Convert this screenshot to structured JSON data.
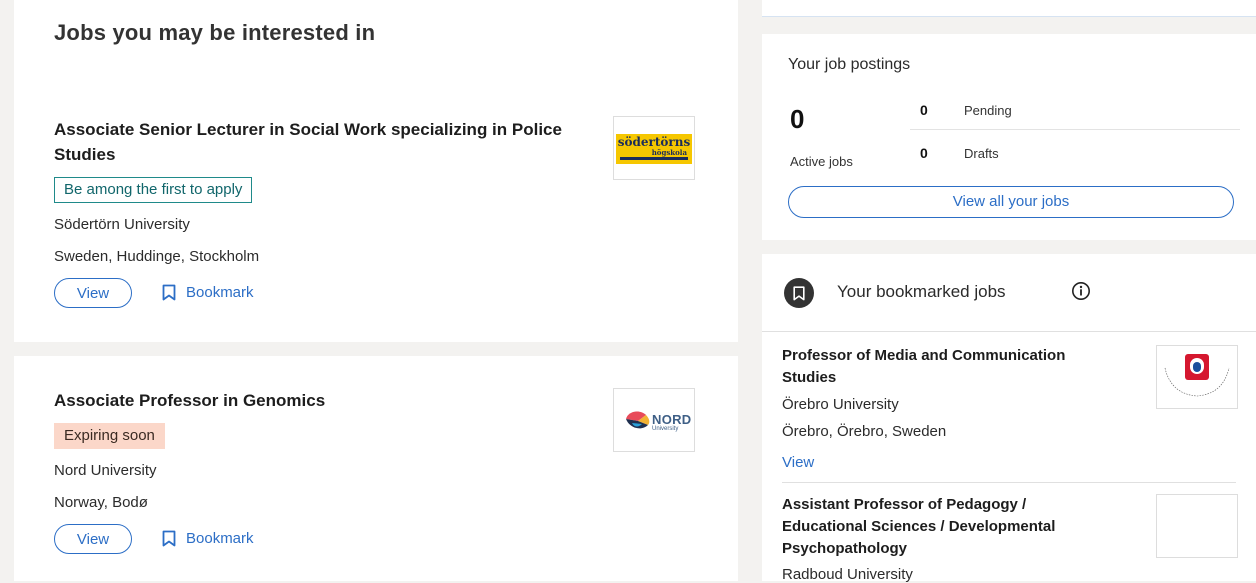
{
  "main": {
    "section_title": "Jobs you may be interested in",
    "jobs": [
      {
        "title": "Associate Senior Lecturer in Social Work specializing in Police Studies",
        "badge": "Be among the first to apply",
        "institution": "Södertörn University",
        "location": "Sweden, Huddinge, Stockholm",
        "view_label": "View",
        "bookmark_label": "Bookmark",
        "logo": {
          "line1": "södertörns",
          "line2": "högskola",
          "bg_color": "#f6c700",
          "text_color": "#1b2c5a"
        }
      },
      {
        "title": "Associate Professor in Genomics",
        "badge": "Expiring soon",
        "institution": "Nord University",
        "location": "Norway, Bodø",
        "view_label": "View",
        "bookmark_label": "Bookmark",
        "logo": {
          "line1": "NORD",
          "line2": "University"
        }
      }
    ]
  },
  "postings": {
    "title": "Your job postings",
    "active_count": "0",
    "active_label": "Active jobs",
    "pending_count": "0",
    "pending_label": "Pending",
    "drafts_count": "0",
    "drafts_label": "Drafts",
    "view_all_label": "View all your jobs"
  },
  "bookmarks": {
    "title": "Your bookmarked jobs",
    "items": [
      {
        "title_line1": "Professor of Media and Communication",
        "title_line2": "Studies",
        "institution": "Örebro University",
        "location": "Örebro, Örebro, Sweden",
        "view_label": "View"
      },
      {
        "title_line1": "Assistant Professor of Pedagogy /",
        "title_line2": "Educational Sciences / Developmental",
        "title_line3": "Psychopathology",
        "institution": "Radboud University"
      }
    ]
  },
  "colors": {
    "accent": "#2c6ec6",
    "badge_first_border": "#1f8a8a",
    "badge_expiring_bg": "#fbd7c9",
    "page_bg": "#f3f2f0"
  },
  "icons": [
    "bookmark-icon",
    "info-icon",
    "nord-logo",
    "orebro-logo"
  ]
}
